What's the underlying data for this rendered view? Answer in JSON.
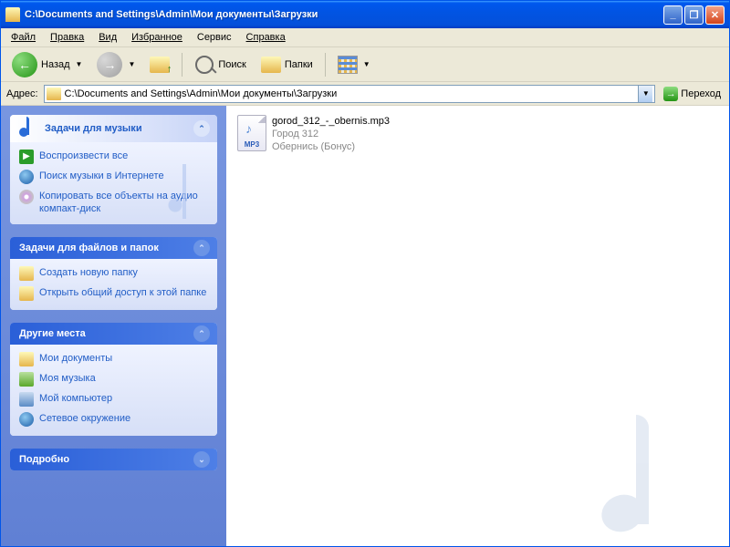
{
  "titlebar": {
    "title": "C:\\Documents and Settings\\Admin\\Мои документы\\Загрузки"
  },
  "menu": {
    "file": "Файл",
    "edit": "Правка",
    "view": "Вид",
    "favorites": "Избранное",
    "tools": "Сервис",
    "help": "Справка"
  },
  "toolbar": {
    "back": "Назад",
    "search": "Поиск",
    "folders": "Папки"
  },
  "addressbar": {
    "label": "Адрес:",
    "path": "C:\\Documents and Settings\\Admin\\Мои документы\\Загрузки",
    "go": "Переход"
  },
  "sidebar": {
    "music_panel": {
      "title": "Задачи для музыки",
      "tasks": {
        "play_all": "Воспроизвести все",
        "shop_online": "Поиск музыки в Интернете",
        "copy_to_cd": "Копировать все объекты на аудио компакт-диск"
      }
    },
    "file_panel": {
      "title": "Задачи для файлов и папок",
      "tasks": {
        "new_folder": "Создать новую папку",
        "share_folder": "Открыть общий доступ к этой папке"
      }
    },
    "other_places": {
      "title": "Другие места",
      "links": {
        "my_documents": "Мои документы",
        "my_music": "Моя музыка",
        "my_computer": "Мой компьютер",
        "network_places": "Сетевое окружение"
      }
    },
    "details": {
      "title": "Подробно"
    }
  },
  "files": [
    {
      "name": "gorod_312_-_obernis.mp3",
      "artist": "Город 312",
      "track": "Обернись (Бонус)",
      "type_label": "MP3"
    }
  ]
}
